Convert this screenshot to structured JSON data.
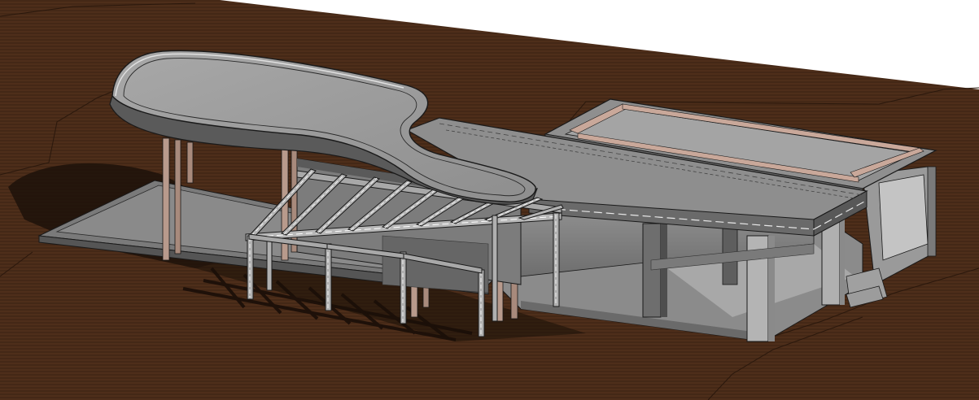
{
  "viewport": {
    "view": "3d-model-view"
  },
  "colors": {
    "background": "#ffffff",
    "terrain": "#4a2b18",
    "terrain_line": "#2a180c",
    "roof_top": "#9e9e9e",
    "roof_edge": "#d8d8d8",
    "concrete_light": "#b8b8b8",
    "concrete_mid": "#8c8c8c",
    "concrete_dark": "#5a5a5a",
    "timber": "#c9a89a",
    "shadow": "#1e120a",
    "outline": "#1a1a1a"
  },
  "icons": {
    "terrain": "topography-surface",
    "building": "building-model"
  }
}
